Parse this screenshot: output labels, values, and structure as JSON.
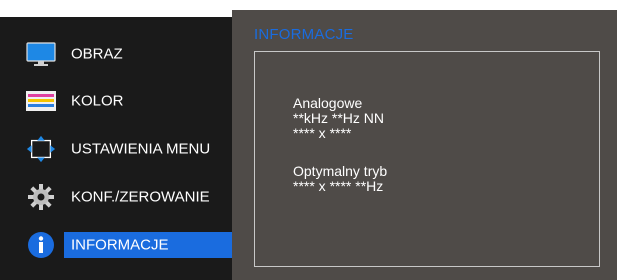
{
  "menu": {
    "items": [
      {
        "label": "OBRAZ",
        "icon": "monitor-icon"
      },
      {
        "label": "KOLOR",
        "icon": "color-bars-icon"
      },
      {
        "label": "USTAWIENIA MENU",
        "icon": "move-arrows-icon"
      },
      {
        "label": "KONF./ZEROWANIE",
        "icon": "gear-icon"
      },
      {
        "label": "INFORMACJE",
        "icon": "info-icon",
        "selected": true
      }
    ]
  },
  "info": {
    "title": "INFORMACJE",
    "signal_type": "Analogowe",
    "frequency": "**kHz **Hz NN",
    "resolution": "**** x ****",
    "optimal_label": "Optymalny tryb",
    "optimal_value": "**** x **** **Hz"
  },
  "colors": {
    "accent": "#1a6cdf",
    "left_bg": "#1a1a1a",
    "right_bg": "#4f4b48"
  }
}
